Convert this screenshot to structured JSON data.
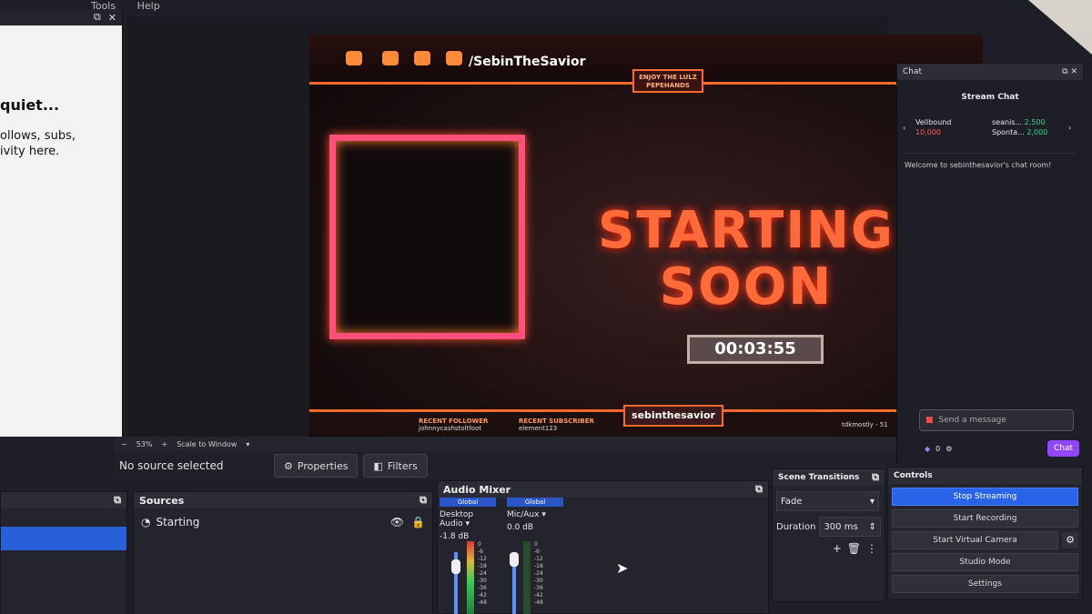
{
  "menu": {
    "items": [
      "Tools",
      "Help"
    ]
  },
  "left_dock": {
    "heading": "quiet...",
    "text_line1": "ollows, subs,",
    "text_line2": "ivity here."
  },
  "preview": {
    "channel_handle": "/SebinTheSavior",
    "banner_line1": "ENJOY THE LULZ",
    "banner_line2": "PEPEHANDS",
    "starting_line1": "STARTING",
    "starting_line2": "SOON",
    "timer": "00:03:55",
    "bottom_handle": "sebinthesavior",
    "recent_follower_title": "RECENT FOLLOWER",
    "recent_follower_name": "johnnycashstoltfoot",
    "recent_subscriber_title": "RECENT SUBSCRIBER",
    "recent_subscriber_name": "element123",
    "recent_donation_name": "tdkmostly - 51"
  },
  "preview_bar": {
    "zoom": "53%",
    "scale_mode": "Scale to Window"
  },
  "properties_row": {
    "status": "No source selected",
    "properties_label": "Properties",
    "filters_label": "Filters"
  },
  "chat": {
    "dock_title": "Chat",
    "title": "Stream Chat",
    "leaders": [
      {
        "name": "Vellbound",
        "amount": "10,000"
      },
      {
        "name": "Sponta...",
        "amount": "2,000"
      },
      {
        "name": "seanis...",
        "amount": "2,500"
      }
    ],
    "welcome": "Welcome to sebinthesavior's chat room!",
    "input_placeholder": "Send a message",
    "points": "0",
    "chat_button": "Chat"
  },
  "sources": {
    "title": "Sources",
    "items": [
      {
        "name": "Starting"
      }
    ]
  },
  "mixer": {
    "title": "Audio Mixer",
    "channels": [
      {
        "global_label": "Global",
        "name": "Desktop Audio",
        "level": "-1.8 dB"
      },
      {
        "global_label": "Global",
        "name": "Mic/Aux",
        "level": "0.0 dB"
      }
    ],
    "ticks": [
      "0",
      "-6",
      "-12",
      "-18",
      "-24",
      "-30",
      "-36",
      "-42",
      "-48"
    ]
  },
  "transitions": {
    "title": "Scene Transitions",
    "selected": "Fade",
    "duration_label": "Duration",
    "duration_value": "300 ms"
  },
  "controls": {
    "title": "Controls",
    "buttons": [
      "Stop Streaming",
      "Start Recording",
      "Start Virtual Camera",
      "Studio Mode",
      "Settings"
    ]
  },
  "colors": {
    "accent": "#2964e8",
    "twitch": "#9147ff",
    "fire": "#ff6a2a"
  }
}
